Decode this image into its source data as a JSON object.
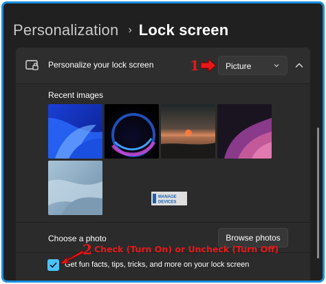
{
  "breadcrumb": {
    "root": "Personalization",
    "separator": "›",
    "page": "Lock screen"
  },
  "lock_screen": {
    "title": "Personalize your lock screen",
    "dropdown_value": "Picture",
    "recent_images_label": "Recent images",
    "choose_photo_label": "Choose a photo",
    "browse_button": "Browse photos",
    "fun_facts_label": "Get fun facts, tips, tricks, and more on your lock screen",
    "fun_facts_checked": true
  },
  "annotations": {
    "step1": "1",
    "step2": "2",
    "step2_text": "Check (Turn On) or Uncheck (Turn Off)",
    "color": "#e81818"
  },
  "watermark": {
    "line1": "MANAGE",
    "line2": "DEVICES"
  },
  "images": [
    {
      "name": "blue-bloom",
      "icon": "wallpaper-thumbnail"
    },
    {
      "name": "dark-glow",
      "icon": "wallpaper-thumbnail"
    },
    {
      "name": "sunset-sea",
      "icon": "wallpaper-thumbnail"
    },
    {
      "name": "purple-ribbon",
      "icon": "wallpaper-thumbnail"
    },
    {
      "name": "light-blue-swirl",
      "icon": "wallpaper-thumbnail"
    }
  ],
  "colors": {
    "frame_border": "#1a8fe0",
    "background": "#202020",
    "card": "#2b2b2b",
    "accent": "#4cc2ff"
  }
}
